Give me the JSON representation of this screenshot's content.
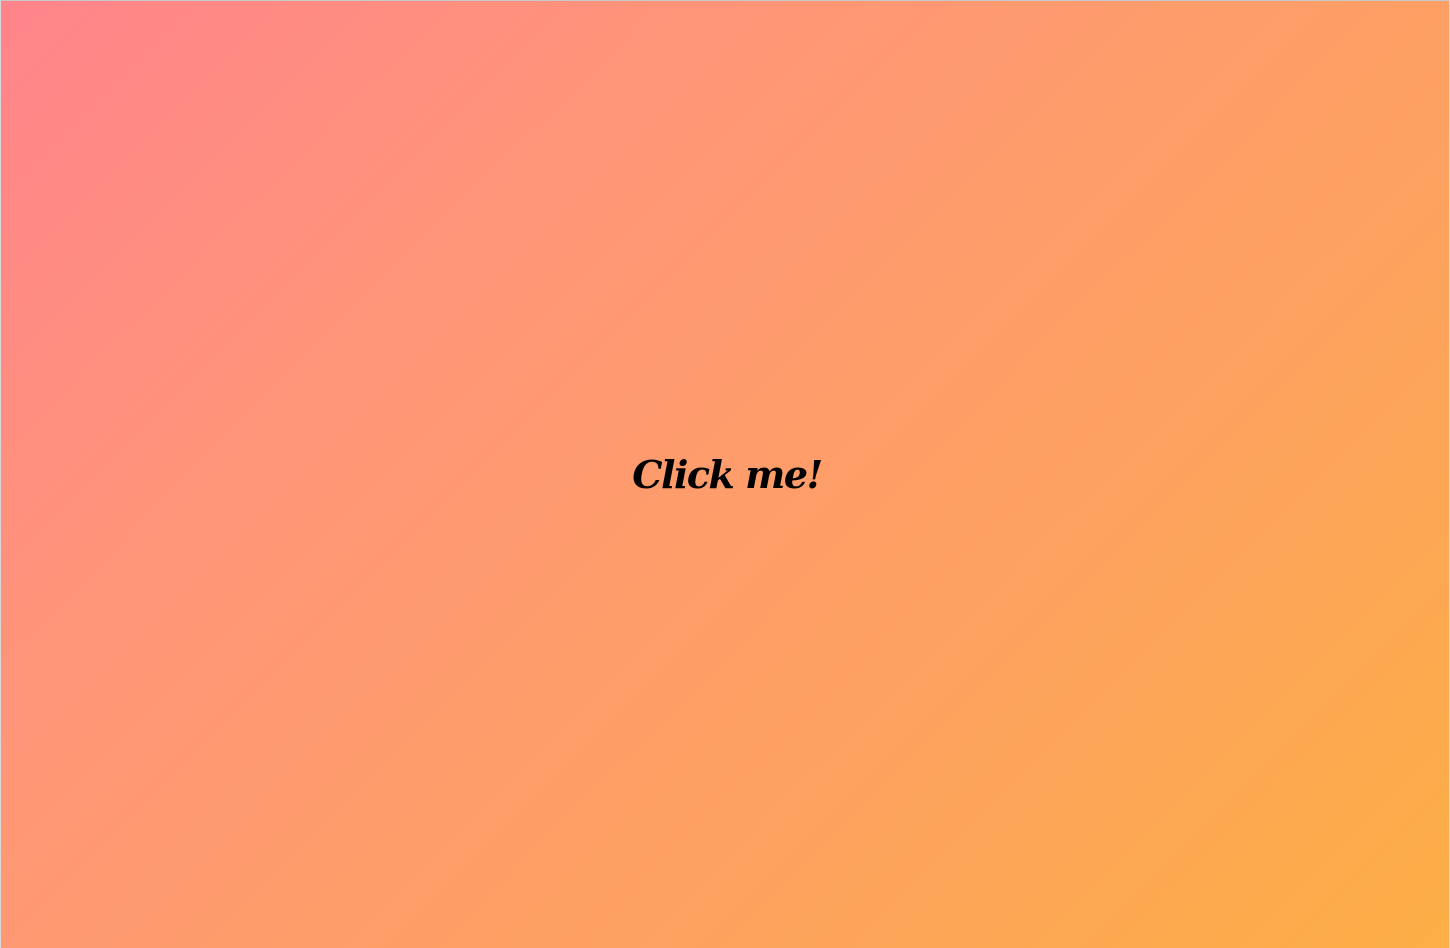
{
  "app": {
    "cta_label": "Click me!"
  },
  "colors": {
    "gradient_start": "#ff848b",
    "gradient_end": "#fdae45",
    "text": "#000000"
  }
}
